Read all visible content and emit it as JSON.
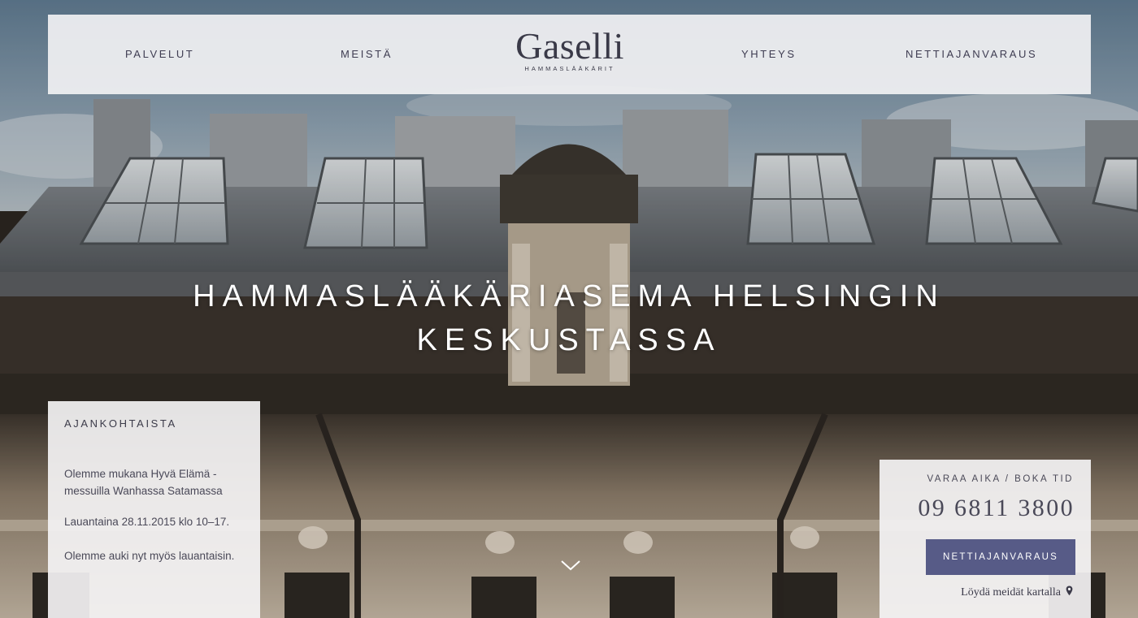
{
  "nav": {
    "left": [
      "PALVELUT",
      "MEISTÄ"
    ],
    "right": [
      "YHTEYS",
      "NETTIAJANVARAUS"
    ]
  },
  "logo": {
    "name": "Gaselli",
    "tagline": "HAMMASLÄÄKÄRIT"
  },
  "hero": {
    "title_line1": "HAMMASLÄÄKÄRIASEMA HELSINGIN",
    "title_line2": "KESKUSTASSA",
    "scroll_icon": "chevron-down-icon"
  },
  "news": {
    "heading": "AJANKOHTAISTA",
    "paragraphs": [
      "Olemme mukana Hyvä Elämä -messuilla Wanhassa Satamassa",
      "Lauantaina 28.11.2015 klo 10–17.",
      "Olemme auki nyt myös lauantaisin."
    ]
  },
  "booking": {
    "label": "VARAA AIKA / BOKA TID",
    "phone": "09 6811 3800",
    "button": "NETTIAJANVARAUS",
    "map_link": "Löydä meidät kartalla",
    "map_icon": "map-pin-icon"
  },
  "colors": {
    "accent": "#575b87",
    "text": "#3c3b4a",
    "panel": "#f4f3f4"
  }
}
